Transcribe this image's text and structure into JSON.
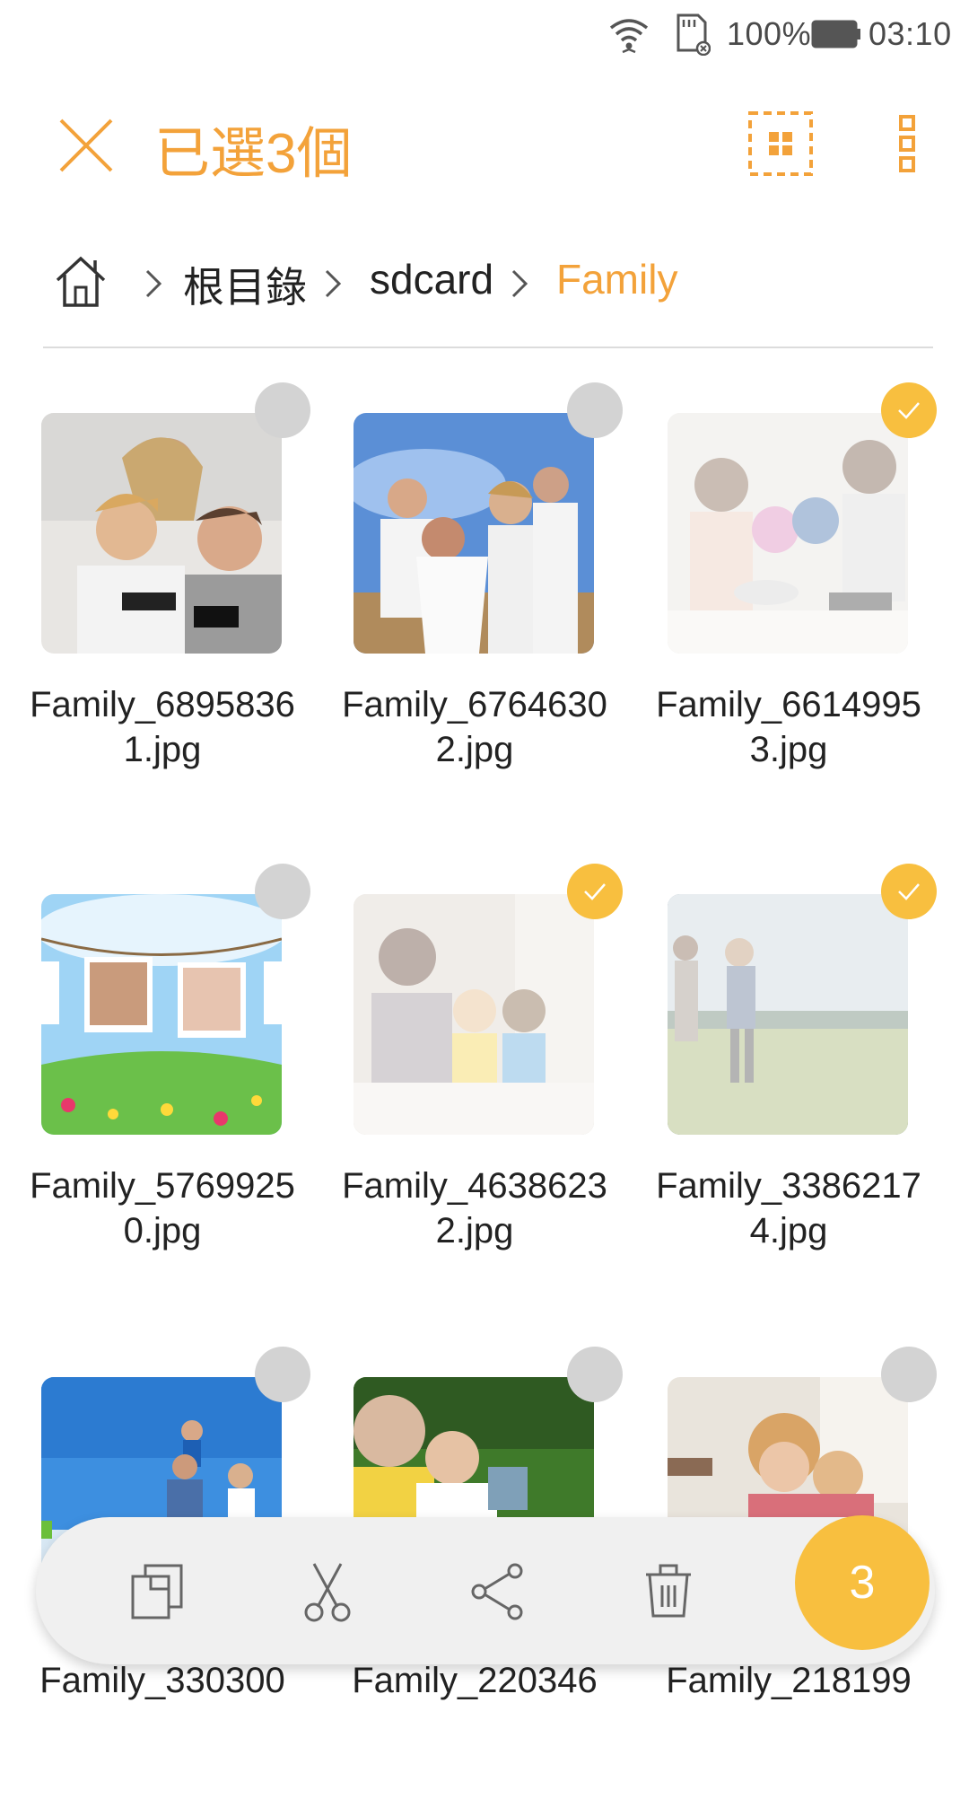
{
  "status": {
    "battery": "100%",
    "time": "03:10"
  },
  "header": {
    "title": "已選3個"
  },
  "breadcrumb": [
    {
      "label": "根目錄"
    },
    {
      "label": "sdcard"
    },
    {
      "label": "Family"
    }
  ],
  "files": [
    {
      "name": "Family_68958361.jpg",
      "selected": false
    },
    {
      "name": "Family_67646302.jpg",
      "selected": false
    },
    {
      "name": "Family_66149953.jpg",
      "selected": true
    },
    {
      "name": "Family_57699250.jpg",
      "selected": false
    },
    {
      "name": "Family_46386232.jpg",
      "selected": true
    },
    {
      "name": "Family_33862174.jpg",
      "selected": true
    },
    {
      "name": "Family_330300",
      "selected": false
    },
    {
      "name": "Family_220346",
      "selected": false
    },
    {
      "name": "Family_218199",
      "selected": false
    }
  ],
  "actionbar": {
    "count": "3"
  },
  "colors": {
    "accent": "#f3a23a",
    "check_on": "#f8bf3f",
    "check_off": "#d3d3d3"
  },
  "icons": [
    "wifi-icon",
    "sdcard-icon",
    "battery-icon",
    "close-icon",
    "select-all-icon",
    "more-icon",
    "home-icon",
    "chevron-right-icon",
    "copy-icon",
    "cut-icon",
    "share-icon",
    "delete-icon",
    "check-icon"
  ]
}
